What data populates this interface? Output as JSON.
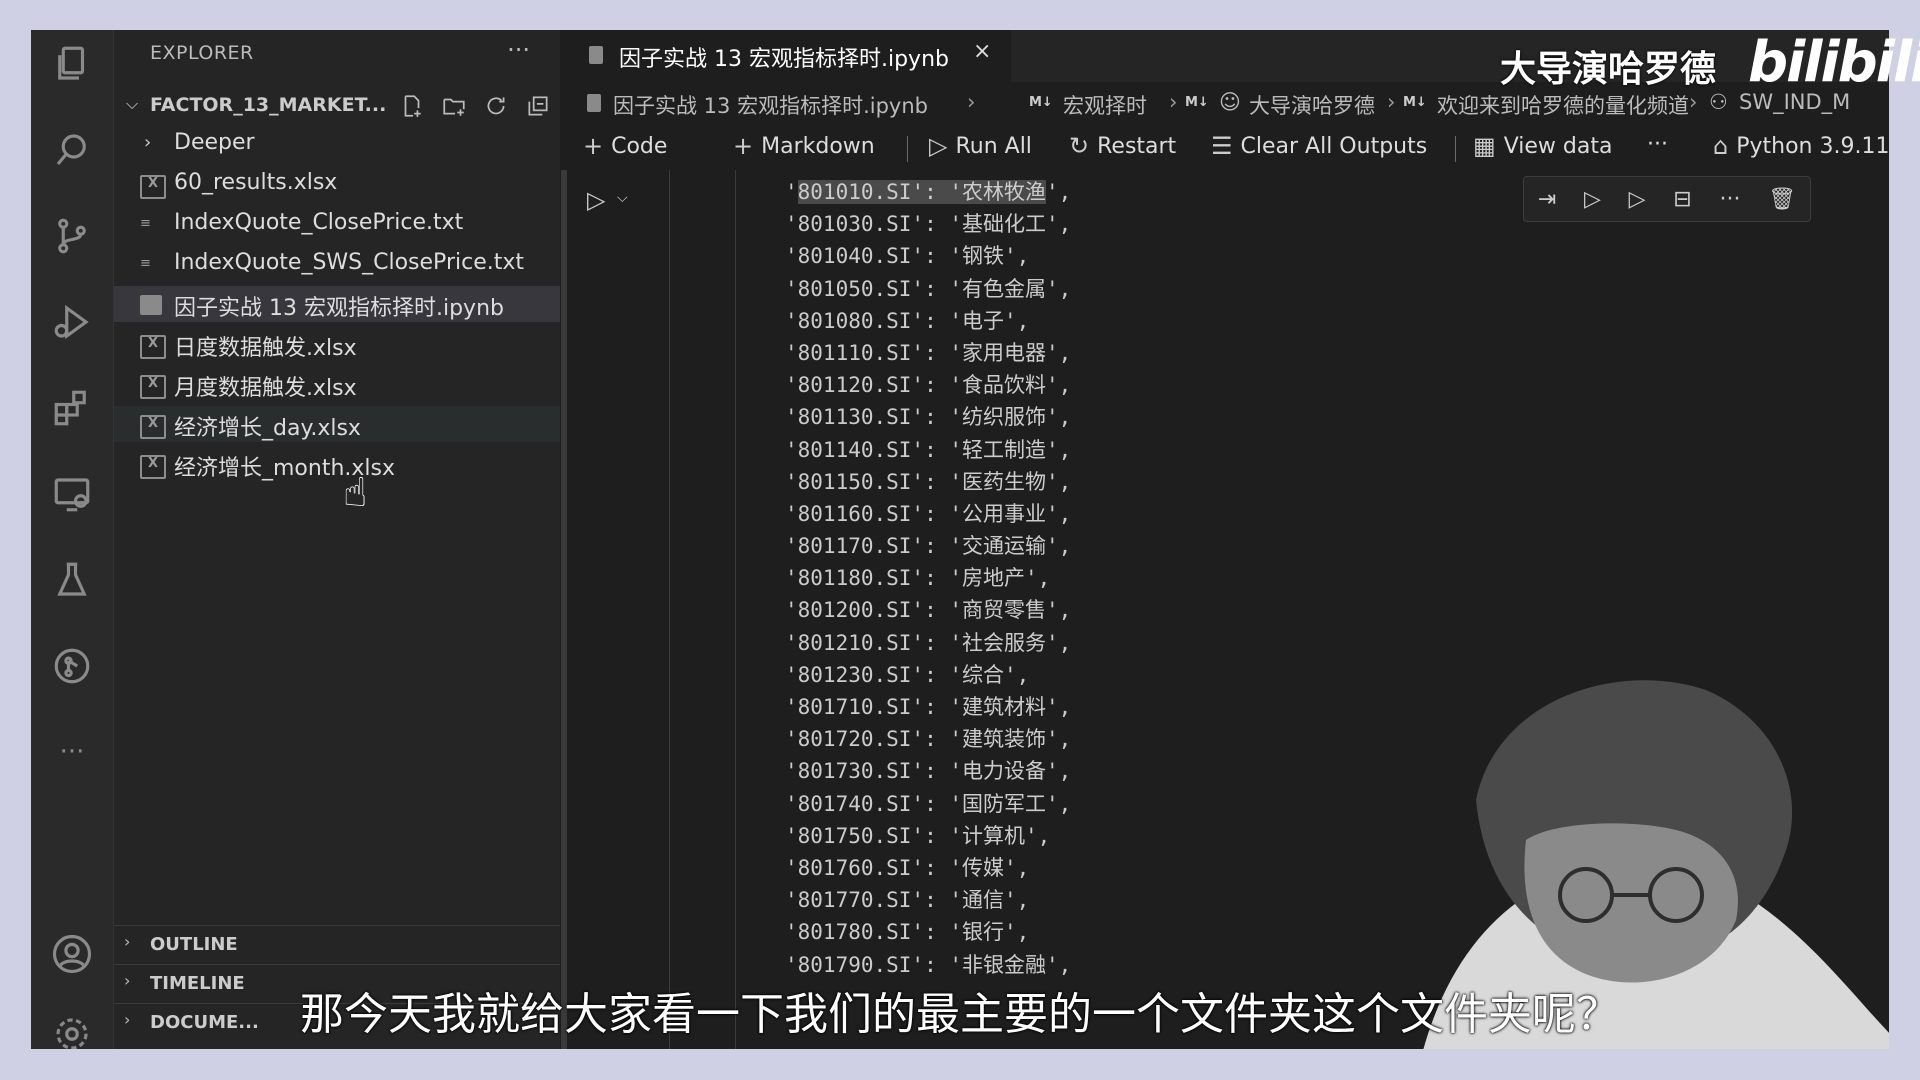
{
  "sidebar": {
    "title": "EXPLORER",
    "more": "···",
    "folder": "FACTOR_13_MARKET...",
    "items": [
      {
        "label": "Deeper",
        "kind": "folder"
      },
      {
        "label": "60_results.xlsx",
        "kind": "xlsx"
      },
      {
        "label": "IndexQuote_ClosePrice.txt",
        "kind": "txt"
      },
      {
        "label": "IndexQuote_SWS_ClosePrice.txt",
        "kind": "txt"
      },
      {
        "label": "因子实战 13 宏观指标择时.ipynb",
        "kind": "ipynb"
      },
      {
        "label": "日度数据触发.xlsx",
        "kind": "xlsx"
      },
      {
        "label": "月度数据触发.xlsx",
        "kind": "xlsx"
      },
      {
        "label": "经济增长_day.xlsx",
        "kind": "xlsx"
      },
      {
        "label": "经济增长_month.xlsx",
        "kind": "xlsx"
      }
    ],
    "panels": [
      "OUTLINE",
      "TIMELINE",
      "DOCUME..."
    ]
  },
  "editor": {
    "tab": {
      "label": "因子实战 13 宏观指标择时.ipynb",
      "close": "×"
    },
    "breadcrumb": {
      "file": "因子实战 13 宏观指标择时.ipynb",
      "b1": "宏观择时",
      "b2": "大导演哈罗德",
      "b3": "欢迎来到哈罗德的量化频道",
      "b4": "SW_IND_M"
    },
    "toolbar": {
      "code": "Code",
      "markdown": "Markdown",
      "run_all": "Run All",
      "restart": "Restart",
      "clear": "Clear All Outputs",
      "view_data": "View data",
      "more": "···",
      "kernel": "Python 3.9.11"
    },
    "code_lines": [
      "'801010.SI': '农林牧渔',",
      "'801030.SI': '基础化工',",
      "'801040.SI': '钢铁',",
      "'801050.SI': '有色金属',",
      "'801080.SI': '电子',",
      "'801110.SI': '家用电器',",
      "'801120.SI': '食品饮料',",
      "'801130.SI': '纺织服饰',",
      "'801140.SI': '轻工制造',",
      "'801150.SI': '医药生物',",
      "'801160.SI': '公用事业',",
      "'801170.SI': '交通运输',",
      "'801180.SI': '房地产',",
      "'801200.SI': '商贸零售',",
      "'801210.SI': '社会服务',",
      "'801230.SI': '综合',",
      "'801710.SI': '建筑材料',",
      "'801720.SI': '建筑装饰',",
      "'801730.SI': '电力设备',",
      "'801740.SI': '国防军工',",
      "'801750.SI': '计算机',",
      "'801760.SI': '传媒',",
      "'801770.SI': '通信',",
      "'801780.SI': '银行',",
      "'801790.SI': '非银金融',"
    ]
  },
  "overlay": {
    "watermark": "大导演哈罗德",
    "logo": "bilibili",
    "subtitle": "那今天我就给大家看一下我们的最主要的一个文件夹这个文件夹呢？"
  }
}
